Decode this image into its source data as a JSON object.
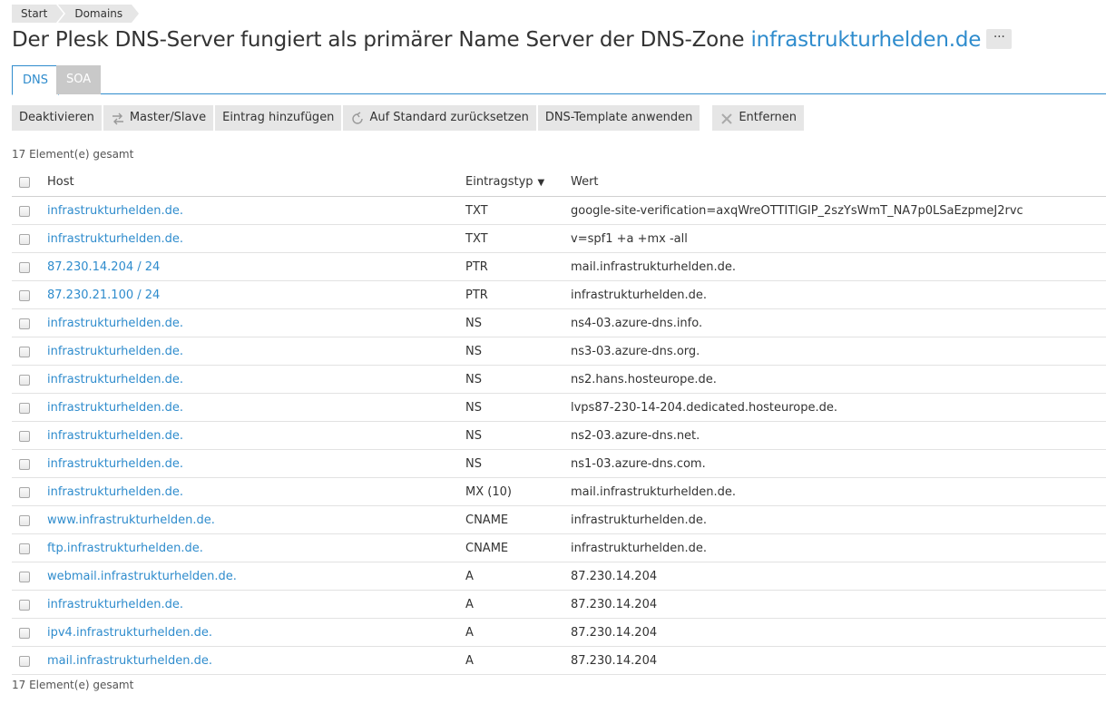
{
  "breadcrumb": {
    "items": [
      "Start",
      "Domains"
    ]
  },
  "title": {
    "text": "Der Plesk DNS-Server fungiert als primärer Name Server der DNS-Zone",
    "domain": "infrastrukturhelden.de",
    "more_label": "···"
  },
  "tabs": {
    "dns": "DNS",
    "soa": "SOA"
  },
  "toolbar": {
    "deactivate": "Deaktivieren",
    "master_slave": "Master/Slave",
    "add_entry": "Eintrag hinzufügen",
    "reset_default": "Auf Standard zurücksetzen",
    "apply_template": "DNS-Template anwenden",
    "remove": "Entfernen"
  },
  "count_label": "17 Element(e) gesamt",
  "table": {
    "headers": {
      "host": "Host",
      "type": "Eintragstyp",
      "value": "Wert"
    },
    "rows": [
      {
        "host": "infrastrukturhelden.de.",
        "type": "TXT",
        "value": "google-site-verification=axqWreOTTITlGIP_2szYsWmT_NA7p0LSaEzpmeJ2rvc"
      },
      {
        "host": "infrastrukturhelden.de.",
        "type": "TXT",
        "value": "v=spf1 +a +mx -all"
      },
      {
        "host": "87.230.14.204 / 24",
        "type": "PTR",
        "value": "mail.infrastrukturhelden.de."
      },
      {
        "host": "87.230.21.100 / 24",
        "type": "PTR",
        "value": "infrastrukturhelden.de."
      },
      {
        "host": "infrastrukturhelden.de.",
        "type": "NS",
        "value": "ns4-03.azure-dns.info."
      },
      {
        "host": "infrastrukturhelden.de.",
        "type": "NS",
        "value": "ns3-03.azure-dns.org."
      },
      {
        "host": "infrastrukturhelden.de.",
        "type": "NS",
        "value": "ns2.hans.hosteurope.de."
      },
      {
        "host": "infrastrukturhelden.de.",
        "type": "NS",
        "value": "lvps87-230-14-204.dedicated.hosteurope.de."
      },
      {
        "host": "infrastrukturhelden.de.",
        "type": "NS",
        "value": "ns2-03.azure-dns.net."
      },
      {
        "host": "infrastrukturhelden.de.",
        "type": "NS",
        "value": "ns1-03.azure-dns.com."
      },
      {
        "host": "infrastrukturhelden.de.",
        "type": "MX (10)",
        "value": "mail.infrastrukturhelden.de."
      },
      {
        "host": "www.infrastrukturhelden.de.",
        "type": "CNAME",
        "value": "infrastrukturhelden.de."
      },
      {
        "host": "ftp.infrastrukturhelden.de.",
        "type": "CNAME",
        "value": "infrastrukturhelden.de."
      },
      {
        "host": "webmail.infrastrukturhelden.de.",
        "type": "A",
        "value": "87.230.14.204"
      },
      {
        "host": "infrastrukturhelden.de.",
        "type": "A",
        "value": "87.230.14.204"
      },
      {
        "host": "ipv4.infrastrukturhelden.de.",
        "type": "A",
        "value": "87.230.14.204"
      },
      {
        "host": "mail.infrastrukturhelden.de.",
        "type": "A",
        "value": "87.230.14.204"
      }
    ]
  }
}
